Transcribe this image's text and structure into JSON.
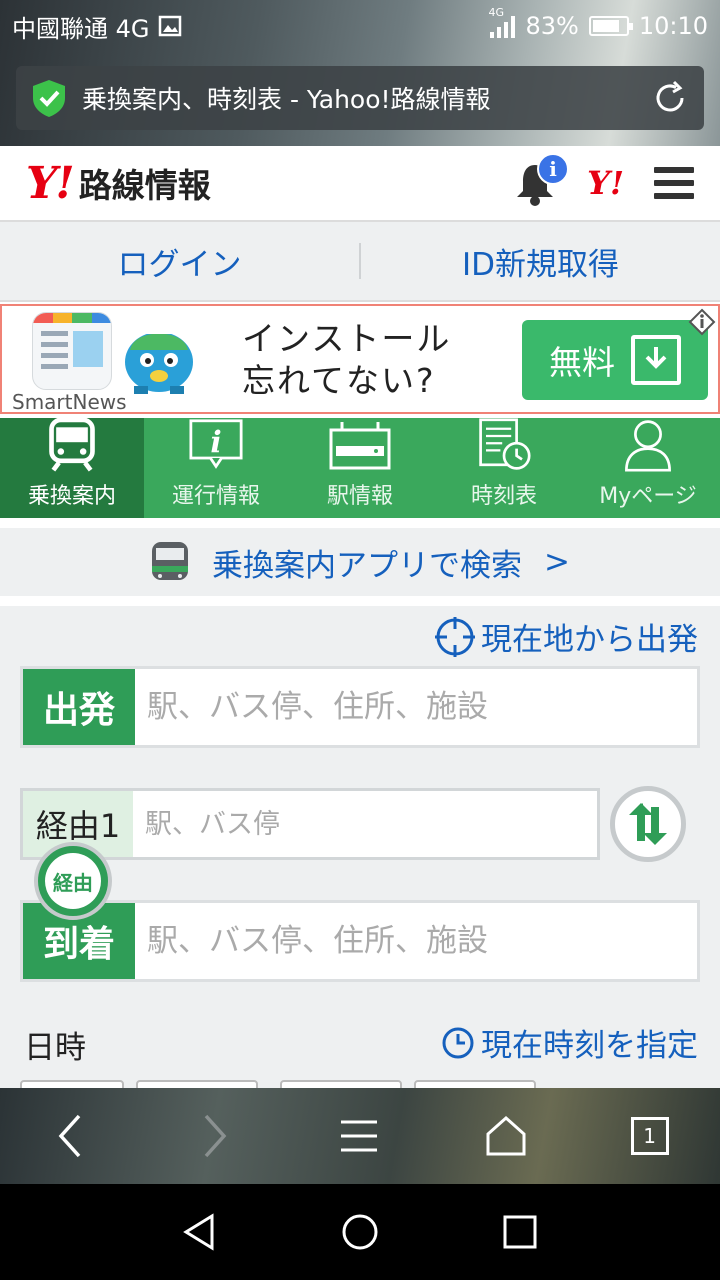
{
  "status_bar": {
    "carrier": "中國聯通 4G",
    "network_small": "4G",
    "battery": "83%",
    "time": "10:10",
    "battery_level": 0.83
  },
  "browser": {
    "page_title": "乗換案内、時刻表 - Yahoo!路線情報",
    "tab_count": "1"
  },
  "header": {
    "logo_mark": "Y!",
    "logo_text": "路線情報",
    "notification_badge": "i",
    "yahoo_mark": "Y!"
  },
  "login": {
    "login_label": "ログイン",
    "signup_label": "ID新規取得"
  },
  "ad": {
    "brand": "SmartNews",
    "line1": "インストール",
    "line2": "忘れてない?",
    "cta": "無料"
  },
  "tabs": [
    {
      "label": "乗換案内",
      "icon": "train-icon"
    },
    {
      "label": "運行情報",
      "icon": "info-icon"
    },
    {
      "label": "駅情報",
      "icon": "station-sign-icon"
    },
    {
      "label": "時刻表",
      "icon": "timetable-icon"
    },
    {
      "label": "Myページ",
      "icon": "user-icon"
    }
  ],
  "app_search": {
    "label": "乗換案内アプリで検索",
    "chevron": ">"
  },
  "form": {
    "current_location": "現在地から出発",
    "from_label": "出発",
    "from_placeholder": "駅、バス停、住所、施設",
    "via_label": "経由1",
    "via_placeholder": "駅、バス停",
    "via_toggle": "経由",
    "to_label": "到着",
    "to_placeholder": "駅、バス停、住所、施設",
    "datetime_label": "日時",
    "current_time": "現在時刻を指定"
  },
  "colors": {
    "brand_red": "#e60012",
    "green": "#3aa85c",
    "green_dark": "#247a3f",
    "link_blue": "#1560bd"
  }
}
